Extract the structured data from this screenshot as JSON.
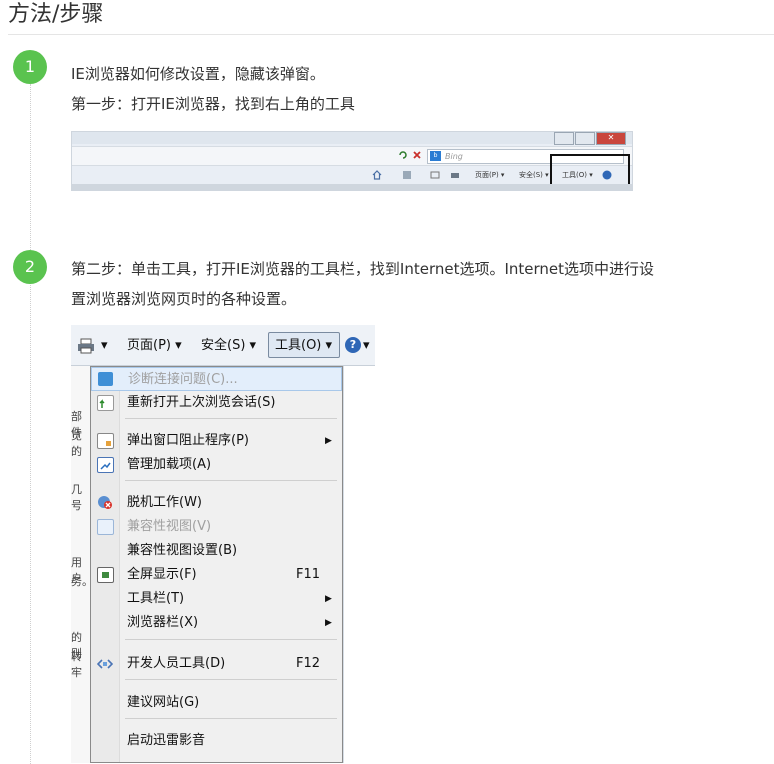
{
  "header": {
    "title": "方法/步骤"
  },
  "steps": [
    {
      "number": "1",
      "lines": [
        "IE浏览器如何修改设置，隐藏该弹窗。",
        "第一步：打开IE浏览器，找到右上角的工具"
      ]
    },
    {
      "number": "2",
      "lines": [
        "第二步：单击工具，打开IE浏览器的工具栏，找到Internet选项。Internet选项中进行设",
        "置浏览器浏览网页时的各种设置。"
      ]
    }
  ],
  "shot1": {
    "search_placeholder": "Bing",
    "bing_logo": "b",
    "close_glyph": "✕",
    "items": [
      "页面(P) ▾",
      "安全(S) ▾",
      "工具(O) ▾"
    ]
  },
  "shot2": {
    "toolbar": {
      "page": "页面(P) ▾",
      "safety": "安全(S) ▾",
      "tools": "工具(O) ▾",
      "help": "?"
    },
    "fragments": [
      "部件",
      "览的",
      "几号",
      "用户",
      "务。",
      "的则",
      "转牢"
    ],
    "menu": [
      {
        "label": "诊断连接问题(C)...",
        "shortcut": "",
        "submenu": "",
        "disabled": true
      },
      {
        "label": "重新打开上次浏览会话(S)",
        "shortcut": "",
        "submenu": "",
        "disabled": false
      },
      {
        "label": "弹出窗口阻止程序(P)",
        "shortcut": "",
        "submenu": "▶",
        "disabled": false
      },
      {
        "label": "管理加载项(A)",
        "shortcut": "",
        "submenu": "",
        "disabled": false
      },
      {
        "label": "脱机工作(W)",
        "shortcut": "",
        "submenu": "",
        "disabled": false
      },
      {
        "label": "兼容性视图(V)",
        "shortcut": "",
        "submenu": "",
        "disabled": true
      },
      {
        "label": "兼容性视图设置(B)",
        "shortcut": "",
        "submenu": "",
        "disabled": false
      },
      {
        "label": "全屏显示(F)",
        "shortcut": "F11",
        "submenu": "",
        "disabled": false
      },
      {
        "label": "工具栏(T)",
        "shortcut": "",
        "submenu": "▶",
        "disabled": false
      },
      {
        "label": "浏览器栏(X)",
        "shortcut": "",
        "submenu": "▶",
        "disabled": false
      },
      {
        "label": "开发人员工具(D)",
        "shortcut": "F12",
        "submenu": "",
        "disabled": false
      },
      {
        "label": "建议网站(G)",
        "shortcut": "",
        "submenu": "",
        "disabled": false
      },
      {
        "label": "启动迅雷影音",
        "shortcut": "",
        "submenu": "",
        "disabled": false
      }
    ]
  },
  "colors": {
    "step_circle": "#5ac34f",
    "text": "#333333",
    "highlight_box": "#111111"
  }
}
